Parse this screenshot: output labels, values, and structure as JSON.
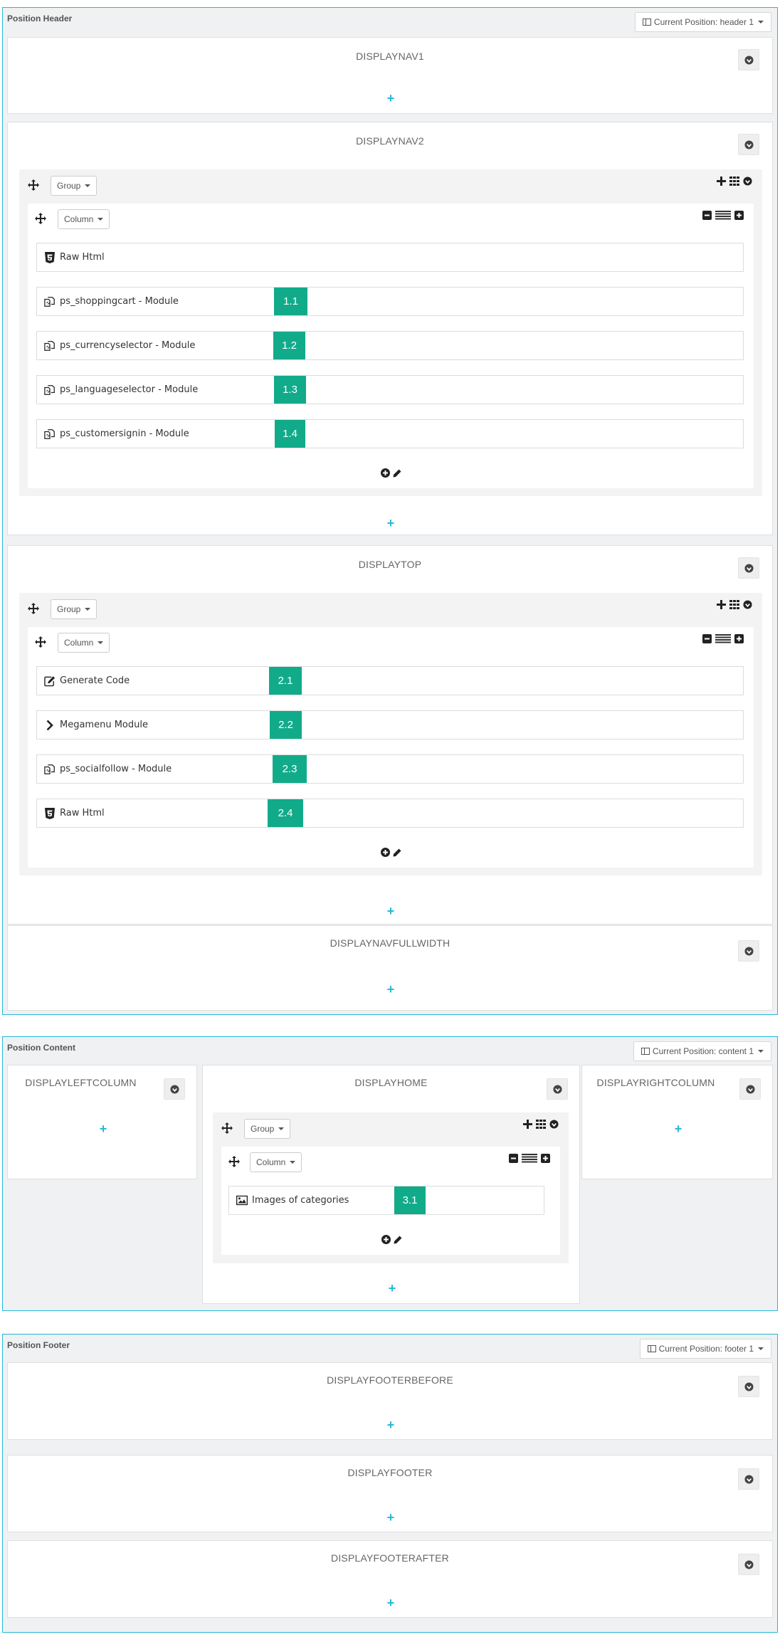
{
  "header": {
    "title": "Position Header",
    "current_position": "Current Position: header 1",
    "hooks": [
      {
        "name": "DISPLAYNAV1"
      },
      {
        "name": "DISPLAYNAV2",
        "group_label": "Group",
        "column_label": "Column",
        "widgets": [
          {
            "label": "Raw Html",
            "icon": "html5-icon",
            "badge": ""
          },
          {
            "label": "ps_shoppingcart - Module",
            "icon": "module-icon",
            "badge": "1.1"
          },
          {
            "label": "ps_currencyselector - Module",
            "icon": "module-icon",
            "badge": "1.2"
          },
          {
            "label": "ps_languageselector - Module",
            "icon": "module-icon",
            "badge": "1.3"
          },
          {
            "label": "ps_customersignin - Module",
            "icon": "module-icon",
            "badge": "1.4"
          }
        ]
      },
      {
        "name": "DISPLAYTOP",
        "group_label": "Group",
        "column_label": "Column",
        "widgets": [
          {
            "label": "Generate Code",
            "icon": "edit-icon",
            "badge": "2.1"
          },
          {
            "label": "Megamenu Module",
            "icon": "chevron-right-icon",
            "badge": "2.2"
          },
          {
            "label": "ps_socialfollow - Module",
            "icon": "module-icon",
            "badge": "2.3"
          },
          {
            "label": "Raw Html",
            "icon": "html5-icon",
            "badge": "2.4"
          }
        ]
      },
      {
        "name": "DISPLAYNAVFULLWIDTH"
      }
    ]
  },
  "content": {
    "title": "Position Content",
    "current_position": "Current Position: content 1",
    "left_column": "DISPLAYLEFTCOLUMN",
    "home": {
      "name": "DISPLAYHOME",
      "group_label": "Group",
      "column_label": "Column",
      "widgets": [
        {
          "label": "Images of categories",
          "icon": "image-icon",
          "badge": "3.1"
        }
      ]
    },
    "right_column": "DISPLAYRIGHTCOLUMN"
  },
  "footer": {
    "title": "Position Footer",
    "current_position": "Current Position: footer 1",
    "hooks": [
      {
        "name": "DISPLAYFOOTERBEFORE"
      },
      {
        "name": "DISPLAYFOOTER"
      },
      {
        "name": "DISPLAYFOOTERAFTER"
      }
    ]
  },
  "colors": {
    "accent": "#25b9d7",
    "badge": "#11ab8a",
    "panel": "#eff1f2"
  }
}
